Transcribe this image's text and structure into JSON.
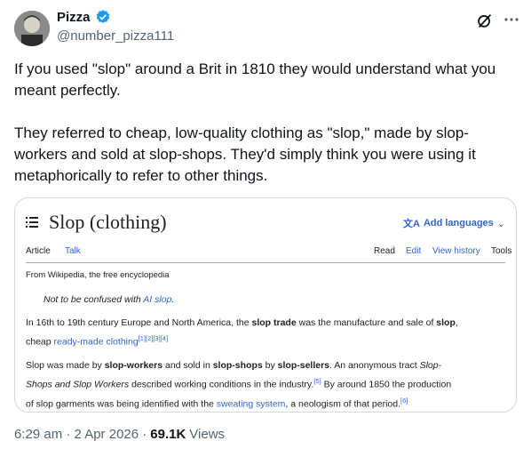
{
  "author": {
    "name": "Pizza",
    "handle": "@number_pizza111"
  },
  "tweet": {
    "paragraphs": [
      "If you used \"slop\" around a Brit in 1810 they would understand what you meant perfectly.",
      "They referred to cheap, low-quality clothing as \"slop,\" made by slop-workers and sold at slop-shops. They'd simply think you were using it metaphorically to refer to other things."
    ]
  },
  "wiki": {
    "title": "Slop (clothing)",
    "add_languages": "Add languages",
    "tabs": {
      "article": "Article",
      "talk": "Talk",
      "read": "Read",
      "edit": "Edit",
      "view_history": "View history",
      "tools": "Tools"
    },
    "from": "From Wikipedia, the free encyclopedia",
    "hatnote": {
      "prefix": "Not to be confused with ",
      "link": "AI slop",
      "suffix": "."
    },
    "p1": {
      "t1": "In 16th to 19th century Europe and North America, the ",
      "b1": "slop trade",
      "t2": " was the manufacture and sale of ",
      "b2": "slop",
      "t3": ",",
      "t4": "cheap ",
      "link": "ready-made clothing",
      "refs": "[1][2][3][4]"
    },
    "p2": {
      "t1": "Slop was made by ",
      "b1": "slop-workers",
      "t2": " and sold in ",
      "b2": "slop-shops",
      "t3": " by ",
      "b3": "slop-sellers",
      "t4": ". An anonymous tract ",
      "i1": "Slop-",
      "i2": "Shops and Slop Workers",
      "t5": " described working conditions in the industry.",
      "ref5": "[5]",
      "t6": " By around 1850 the production",
      "t7": "of slop garments was being identified with the ",
      "link": "sweating system",
      "t8": ", a neologism of that period.",
      "ref6": "[6]"
    }
  },
  "meta": {
    "time": "6:29 am · 2 Apr 2026 · ",
    "views_count": "69.1K",
    "views_label": "Views"
  },
  "colors": {
    "verified": "#1d9bf0",
    "link": "#3366cc",
    "muted": "#536471"
  },
  "icons": [
    "verified-badge-icon",
    "grok-icon",
    "more-icon",
    "hamburger-icon",
    "translate-icon",
    "chevron-down-icon"
  ]
}
